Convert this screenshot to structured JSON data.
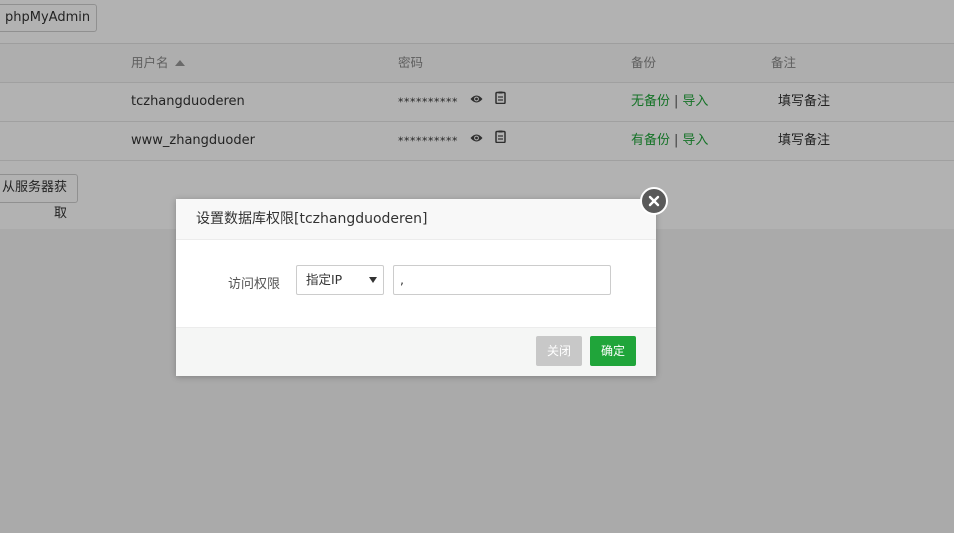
{
  "toolbar": {
    "phpmyadmin_label": "phpMyAdmin"
  },
  "table": {
    "headers": {
      "username": "用户名",
      "password": "密码",
      "backup": "备份",
      "note": "备注"
    },
    "rows": [
      {
        "username": "tczhangduoderen",
        "password": "**********",
        "backup_status": "无备份",
        "import": "导入",
        "note": "填写备注"
      },
      {
        "username": "www_zhangduoder",
        "password": "**********",
        "backup_status": "有备份",
        "import": "导入",
        "note": "填写备注"
      }
    ]
  },
  "fetch_button": {
    "label": "从服务器获取"
  },
  "modal": {
    "title": "设置数据库权限[tczhangduoderen]",
    "access_label": "访问权限",
    "access_select": "指定IP",
    "ip_value": ",",
    "close_label": "关闭",
    "ok_label": "确定"
  },
  "colors": {
    "accent": "#20a53a",
    "overlay": "rgba(0,0,0,0.3)",
    "close_button": "#c8c8c8"
  },
  "icons": [
    "sort-asc-icon",
    "eye-icon",
    "copy-icon",
    "dropdown-caret-icon",
    "close-circle-icon"
  ]
}
